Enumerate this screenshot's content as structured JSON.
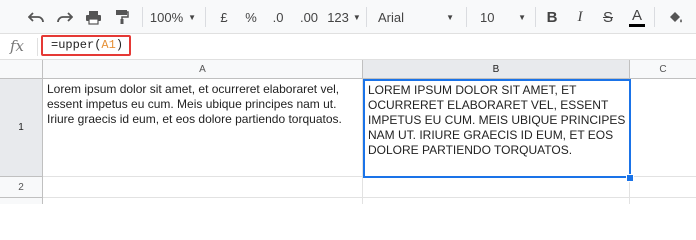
{
  "toolbar": {
    "zoom": "100%",
    "currency": "£",
    "percent": "%",
    "decrease_decimals": ".0",
    "increase_decimals": ".00",
    "more_formats": "123",
    "font": "Arial",
    "font_size": "10",
    "bold": "B",
    "italic": "I",
    "strikethrough": "S",
    "text_color_letter": "A"
  },
  "formula_bar": {
    "fx": "fx",
    "prefix": "=upper(",
    "ref": "A1",
    "suffix": ")"
  },
  "grid": {
    "columns": [
      "A",
      "B",
      "C"
    ],
    "rows": [
      "1",
      "2"
    ],
    "cell_a1": "Lorem ipsum dolor sit amet, et ocurreret elaboraret vel, essent impetus eu cum. Meis ubique principes nam ut. Iriure graecis id eum, et eos dolore partiendo torquatos.",
    "cell_b1": "LOREM IPSUM DOLOR SIT AMET, ET OCURRERET ELABORARET VEL, ESSENT IMPETUS EU CUM. MEIS UBIQUE PRINCIPES NAM UT. IRIURE GRAECIS ID EUM, ET EOS DOLORE PARTIENDO TORQUATOS."
  },
  "colors": {
    "selection": "#1a73e8",
    "formula_highlight": "#e53935",
    "ref_color": "#e69138"
  }
}
